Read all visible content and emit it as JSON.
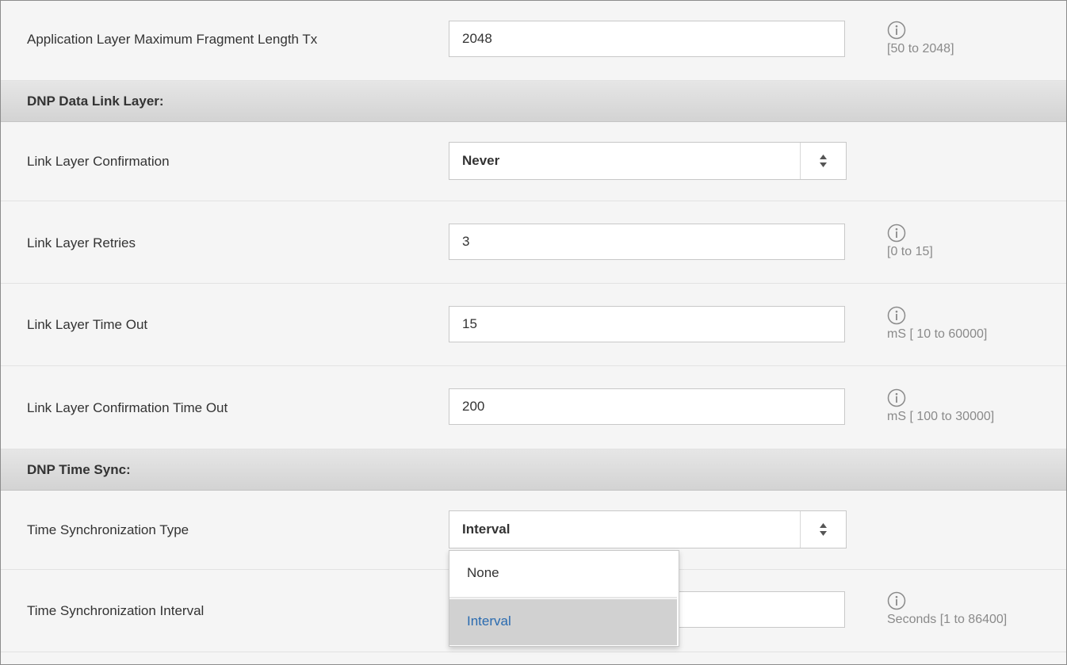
{
  "rows": {
    "app_frag": {
      "label": "Application Layer Maximum Fragment Length Tx",
      "value": "2048",
      "hint": "[50 to 2048]"
    },
    "link_confirm": {
      "label": "Link Layer Confirmation",
      "selected": "Never"
    },
    "link_retries": {
      "label": "Link Layer Retries",
      "value": "3",
      "hint": "[0 to 15]"
    },
    "link_timeout": {
      "label": "Link Layer Time Out",
      "value": "15",
      "hint": "mS [ 10 to 60000]"
    },
    "link_confirm_timeout": {
      "label": "Link Layer Confirmation Time Out",
      "value": "200",
      "hint": "mS [ 100 to 30000]"
    },
    "time_sync_type": {
      "label": "Time Synchronization Type",
      "selected": "Interval",
      "options": [
        "None",
        "Interval"
      ]
    },
    "time_sync_interval": {
      "label": "Time Synchronization Interval",
      "value": "",
      "hint": "Seconds [1 to 86400]"
    }
  },
  "sections": {
    "data_link": "DNP Data Link Layer:",
    "time_sync": "DNP Time Sync:"
  },
  "icons": {
    "info": "info-circle-icon",
    "select_arrows": "sort-arrows-icon"
  },
  "colors": {
    "selected_option_text": "#2a6bb0",
    "hint_text": "#8a8a8a"
  }
}
